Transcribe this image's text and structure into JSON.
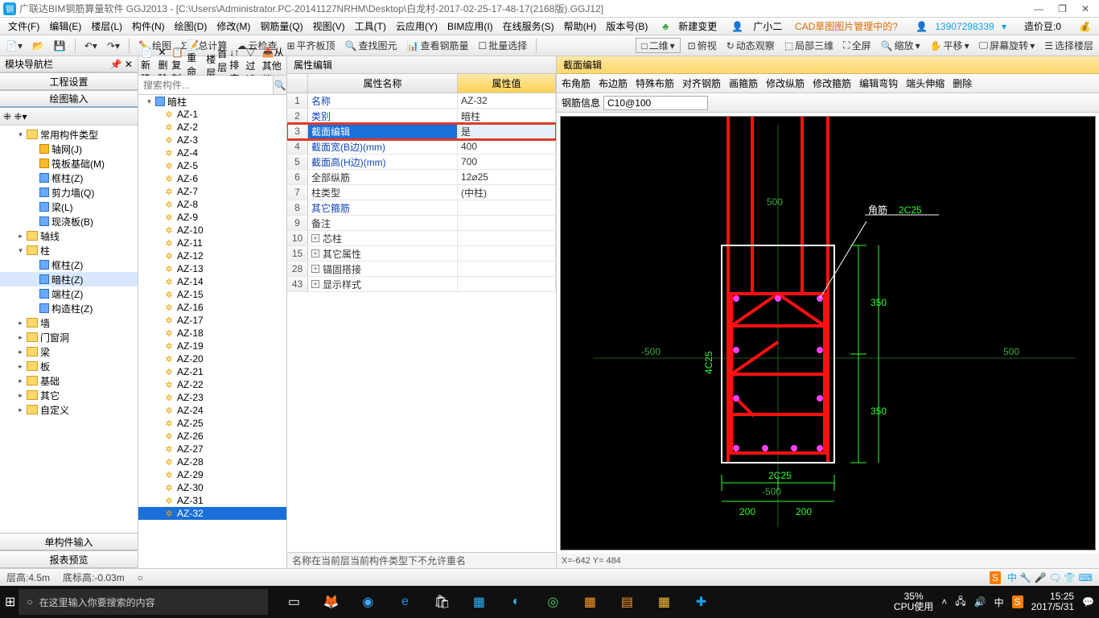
{
  "title": "广联达BIM钢筋算量软件 GGJ2013 - [C:\\Users\\Administrator.PC-20141127NRHM\\Desktop\\白龙村-2017-02-25-17-48-17(2168版).GGJ12]",
  "menu": [
    "文件(F)",
    "编辑(E)",
    "楼层(L)",
    "构件(N)",
    "绘图(D)",
    "修改(M)",
    "钢筋量(Q)",
    "视图(V)",
    "工具(T)",
    "云应用(Y)",
    "BIM应用(I)",
    "在线服务(S)",
    "帮助(H)",
    "版本号(B)"
  ],
  "menu_right": {
    "new": "新建变更",
    "user": "广小二",
    "cad": "CAD草图图片管理中的?",
    "phone": "13907298339",
    "price": "造价豆:0"
  },
  "toolbar1": [
    "绘图",
    "汇总计算",
    "云检查",
    "平齐板顶",
    "查找图元",
    "查看钢筋量",
    "批量选择"
  ],
  "toolbar1r": [
    "二维",
    "俯视",
    "动态观察",
    "局部三维",
    "全屏",
    "缩放",
    "平移",
    "屏幕旋转",
    "选择楼层"
  ],
  "nav": {
    "title": "模块导航栏",
    "btn1": "工程设置",
    "btn2": "绘图输入"
  },
  "tree": [
    {
      "label": "常用构件类型",
      "depth": 1,
      "exp": "▾",
      "folder": true
    },
    {
      "label": "轴网(J)",
      "depth": 2,
      "ico": "grid"
    },
    {
      "label": "筏板基础(M)",
      "depth": 2,
      "ico": "grid"
    },
    {
      "label": "框柱(Z)",
      "depth": 2,
      "ico": "col"
    },
    {
      "label": "剪力墙(Q)",
      "depth": 2,
      "ico": "col"
    },
    {
      "label": "梁(L)",
      "depth": 2,
      "ico": "col"
    },
    {
      "label": "现浇板(B)",
      "depth": 2,
      "ico": "col"
    },
    {
      "label": "轴线",
      "depth": 1,
      "exp": "▸",
      "folder": true
    },
    {
      "label": "柱",
      "depth": 1,
      "exp": "▾",
      "folder": true
    },
    {
      "label": "框柱(Z)",
      "depth": 2,
      "ico": "col"
    },
    {
      "label": "暗柱(Z)",
      "depth": 2,
      "ico": "col",
      "sel": true
    },
    {
      "label": "端柱(Z)",
      "depth": 2,
      "ico": "col"
    },
    {
      "label": "构造柱(Z)",
      "depth": 2,
      "ico": "col"
    },
    {
      "label": "墙",
      "depth": 1,
      "exp": "▸",
      "folder": true
    },
    {
      "label": "门窗洞",
      "depth": 1,
      "exp": "▸",
      "folder": true
    },
    {
      "label": "梁",
      "depth": 1,
      "exp": "▸",
      "folder": true
    },
    {
      "label": "板",
      "depth": 1,
      "exp": "▸",
      "folder": true
    },
    {
      "label": "基础",
      "depth": 1,
      "exp": "▸",
      "folder": true
    },
    {
      "label": "其它",
      "depth": 1,
      "exp": "▸",
      "folder": true
    },
    {
      "label": "自定义",
      "depth": 1,
      "exp": "▸",
      "folder": true
    }
  ],
  "nav_bottom": [
    "单构件输入",
    "报表预览"
  ],
  "cp_toolbar": [
    "新建",
    "删除",
    "复制",
    "重命名",
    "楼层",
    "首层"
  ],
  "cp_toolbar2": [
    "排序",
    "过滤",
    "从其他楼"
  ],
  "cp_search_ph": "搜索构件...",
  "cp_root": "暗柱",
  "cp_items": [
    "AZ-1",
    "AZ-2",
    "AZ-3",
    "AZ-4",
    "AZ-5",
    "AZ-6",
    "AZ-7",
    "AZ-8",
    "AZ-9",
    "AZ-10",
    "AZ-11",
    "AZ-12",
    "AZ-13",
    "AZ-14",
    "AZ-15",
    "AZ-16",
    "AZ-17",
    "AZ-18",
    "AZ-19",
    "AZ-20",
    "AZ-21",
    "AZ-22",
    "AZ-23",
    "AZ-24",
    "AZ-25",
    "AZ-26",
    "AZ-27",
    "AZ-28",
    "AZ-29",
    "AZ-30",
    "AZ-31",
    "AZ-32"
  ],
  "cp_selected": "AZ-32",
  "prop_title": "属性编辑",
  "prop_head": [
    "属性名称",
    "属性值"
  ],
  "prop_rows": [
    {
      "i": "1",
      "n": "名称",
      "v": "AZ-32",
      "link": true
    },
    {
      "i": "2",
      "n": "类别",
      "v": "暗柱",
      "link": true
    },
    {
      "i": "3",
      "n": "截面编辑",
      "v": "是",
      "link": true,
      "sel": true
    },
    {
      "i": "4",
      "n": "截面宽(B边)(mm)",
      "v": "400",
      "link": true
    },
    {
      "i": "5",
      "n": "截面高(H边)(mm)",
      "v": "700",
      "link": true
    },
    {
      "i": "6",
      "n": "全部纵筋",
      "v": "12⌀25"
    },
    {
      "i": "7",
      "n": "柱类型",
      "v": "(中柱)"
    },
    {
      "i": "8",
      "n": "其它箍筋",
      "v": "",
      "link": true
    },
    {
      "i": "9",
      "n": "备注",
      "v": ""
    },
    {
      "i": "10",
      "n": "芯柱",
      "v": "",
      "box": true
    },
    {
      "i": "15",
      "n": "其它属性",
      "v": "",
      "box": true
    },
    {
      "i": "28",
      "n": "锚固搭接",
      "v": "",
      "box": true
    },
    {
      "i": "43",
      "n": "显示样式",
      "v": "",
      "box": true
    }
  ],
  "prop_status": "名称在当前层当前构件类型下不允许重名",
  "sec_title": "截面编辑",
  "sec_tools": [
    "布角筋",
    "布边筋",
    "特殊布筋",
    "对齐钢筋",
    "画箍筋",
    "修改纵筋",
    "修改箍筋",
    "编辑弯钩",
    "端头伸缩",
    "删除"
  ],
  "sec_info_label": "钢筋信息",
  "sec_info_value": "C10@100",
  "sec_labels": {
    "corner": "角筋",
    "c2c25": "2C25",
    "c4c25": "4C25",
    "d350": "350",
    "d200": "200"
  },
  "sec_coord": "X=-642 Y= 484",
  "status": {
    "lh": "层高:4.5m",
    "bh": "底标高:-0.03m"
  },
  "taskbar": {
    "search": "在这里输入你要搜索的内容",
    "cpu1": "35%",
    "cpu2": "CPU使用",
    "time": "15:25",
    "date": "2017/5/31"
  }
}
